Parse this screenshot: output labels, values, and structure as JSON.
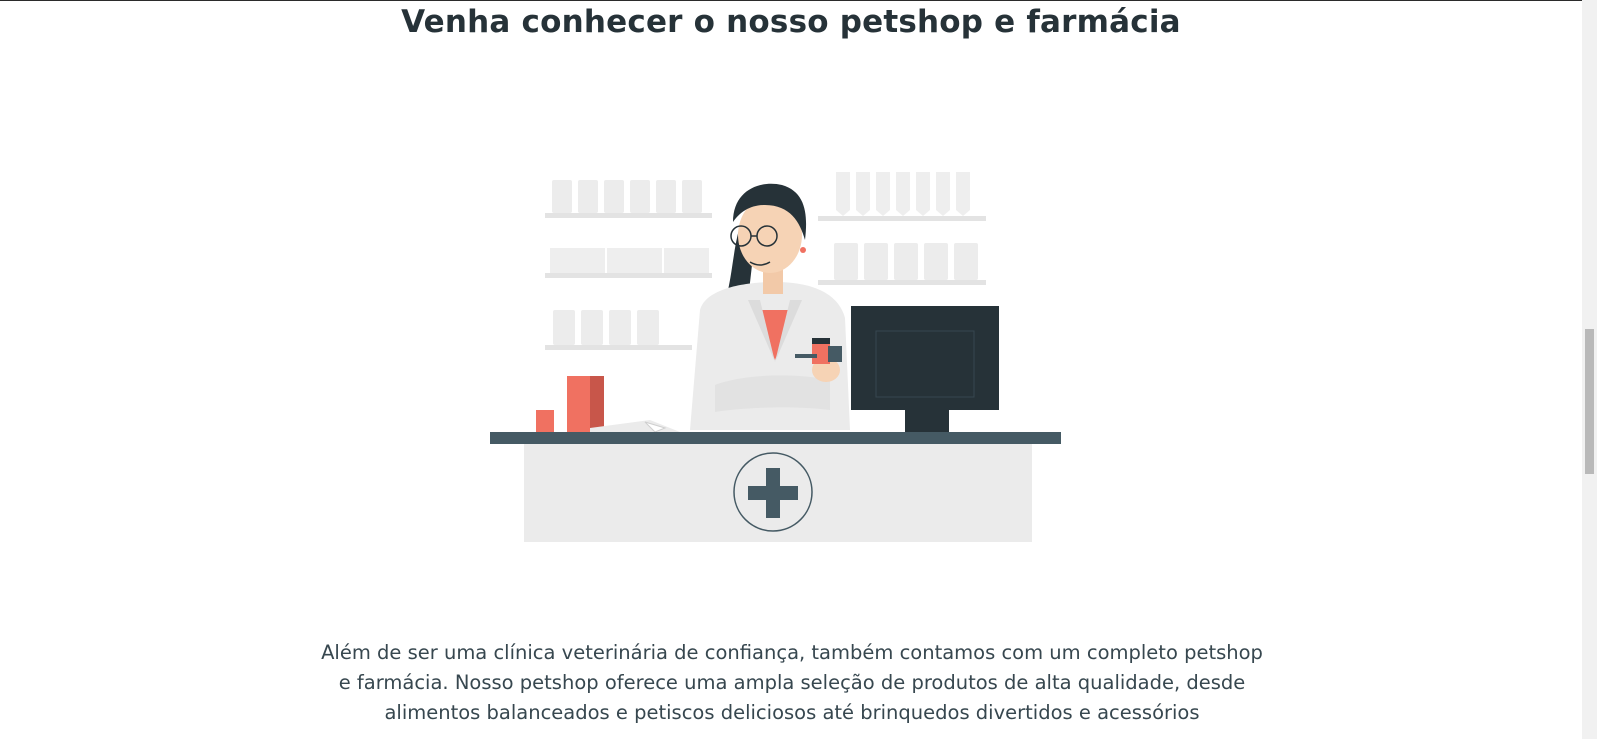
{
  "section": {
    "title": "Venha conhecer o nosso petshop e farmácia",
    "paragraph": "Além de ser uma clínica veterinária de confiança, também contamos com um completo petshop e farmácia. Nosso petshop oferece uma ampla seleção de produtos de alta qualidade, desde alimentos balanceados e petiscos deliciosos até brinquedos divertidos e acessórios"
  },
  "illustration": {
    "subject": "pharmacist-at-counter",
    "icon": "medical-cross-icon"
  },
  "colors": {
    "text_dark": "#263238",
    "accent": "#f07161",
    "counter": "#455a64",
    "light_gray": "#ebebeb"
  },
  "scrollbar": {
    "position": 0.45
  }
}
